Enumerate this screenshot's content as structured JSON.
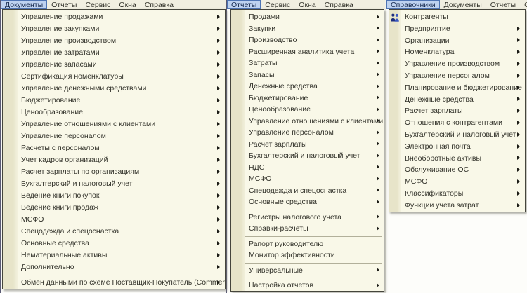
{
  "theme": {
    "bar-bg": "#f1efe1",
    "panel-bg": "#f9f8e8",
    "strip-a": "#e7e4c9",
    "strip-b": "#f3f1de",
    "sel-bg": "#bed2f0",
    "sel-border": "#4e74b4",
    "sel-text": "#16294e",
    "text": "#32322a",
    "panel-border": "#45453c",
    "sep": "#b2b09a",
    "arrow": "#1b1b15"
  },
  "windows": [
    {
      "id": "documents",
      "menubar": {
        "items": [
          {
            "label": "Документы",
            "selected": true
          },
          {
            "label": "Отчеты"
          },
          {
            "label": "Сервис",
            "u": 0
          },
          {
            "label": "Окна",
            "u": 0
          },
          {
            "label": "Справка",
            "u": 2
          }
        ]
      },
      "menu": {
        "items": [
          {
            "label": "Управление продажами",
            "submenu": true
          },
          {
            "label": "Управление закупками",
            "submenu": true
          },
          {
            "label": "Управление производством",
            "submenu": true
          },
          {
            "label": "Управление затратами",
            "submenu": true
          },
          {
            "label": "Управление запасами",
            "submenu": true
          },
          {
            "label": "Сертификация номенклатуры",
            "submenu": true
          },
          {
            "label": "Управление денежными средствами",
            "submenu": true
          },
          {
            "label": "Бюджетирование",
            "submenu": true
          },
          {
            "label": "Ценообразование",
            "submenu": true
          },
          {
            "label": "Управление отношениями с клиентами",
            "submenu": true
          },
          {
            "label": "Управление персоналом",
            "submenu": true
          },
          {
            "label": "Расчеты с персоналом",
            "submenu": true
          },
          {
            "label": "Учет кадров организаций",
            "submenu": true
          },
          {
            "label": "Расчет зарплаты по организациям",
            "submenu": true
          },
          {
            "label": "Бухгалтерский и налоговый учет",
            "submenu": true
          },
          {
            "label": "Ведение книги покупок",
            "submenu": true
          },
          {
            "label": "Ведение книги продаж",
            "submenu": true
          },
          {
            "label": "МСФО",
            "submenu": true
          },
          {
            "label": "Спецодежда и спецоснастка",
            "submenu": true
          },
          {
            "label": "Основные средства",
            "submenu": true
          },
          {
            "label": "Нематериальные активы",
            "submenu": true
          },
          {
            "label": "Дополнительно",
            "submenu": true
          },
          {
            "label": "Обмен данными по схеме Поставщик-Покупатель (CommerceML)",
            "submenu": true,
            "sep_before": true
          }
        ]
      }
    },
    {
      "id": "reports",
      "menubar": {
        "items": [
          {
            "label": "Отчеты",
            "selected": true
          },
          {
            "label": "Сервис",
            "u": 0
          },
          {
            "label": "Окна",
            "u": 0
          },
          {
            "label": "Справка",
            "u": 2
          }
        ]
      },
      "menu": {
        "items": [
          {
            "label": "Продажи",
            "submenu": true
          },
          {
            "label": "Закупки",
            "submenu": true
          },
          {
            "label": "Производство",
            "submenu": true
          },
          {
            "label": "Расширенная аналитика учета",
            "submenu": true
          },
          {
            "label": "Затраты",
            "submenu": true
          },
          {
            "label": "Запасы",
            "submenu": true
          },
          {
            "label": "Денежные средства",
            "submenu": true
          },
          {
            "label": "Бюджетирование",
            "submenu": true
          },
          {
            "label": "Ценообразование",
            "submenu": true
          },
          {
            "label": "Управление отношениями с клиентами",
            "submenu": true
          },
          {
            "label": "Управление персоналом",
            "submenu": true
          },
          {
            "label": "Расчет зарплаты",
            "submenu": true
          },
          {
            "label": "Бухгалтерский и налоговый учет",
            "submenu": true
          },
          {
            "label": "НДС",
            "submenu": true
          },
          {
            "label": "МСФО",
            "submenu": true
          },
          {
            "label": "Спецодежда и спецоснастка",
            "submenu": true
          },
          {
            "label": "Основные средства",
            "submenu": true
          },
          {
            "label": "Регистры налогового учета",
            "submenu": true,
            "sep_before": true
          },
          {
            "label": "Справки-расчеты",
            "submenu": true
          },
          {
            "label": "Рапорт руководителю",
            "submenu": false,
            "sep_before": true
          },
          {
            "label": "Монитор эффективности",
            "submenu": false
          },
          {
            "label": "Универсальные",
            "submenu": true,
            "sep_before": true
          },
          {
            "label": "Настройка отчетов",
            "submenu": true,
            "sep_before": true
          }
        ]
      }
    },
    {
      "id": "directories",
      "menubar": {
        "items": [
          {
            "label": "Справочники",
            "selected": true
          },
          {
            "label": "Документы"
          },
          {
            "label": "Отчеты"
          },
          {
            "label": "Сервис",
            "u": 0
          }
        ]
      },
      "menu": {
        "items": [
          {
            "label": "Контрагенты",
            "submenu": false,
            "icon": "contractors-icon"
          },
          {
            "label": "Предприятие",
            "submenu": true
          },
          {
            "label": "Организации",
            "submenu": true
          },
          {
            "label": "Номенклатура",
            "submenu": true
          },
          {
            "label": "Управление производством",
            "submenu": true
          },
          {
            "label": "Управление персоналом",
            "submenu": true
          },
          {
            "label": "Планирование и бюджетирование",
            "submenu": true
          },
          {
            "label": "Денежные средства",
            "submenu": true
          },
          {
            "label": "Расчет зарплаты",
            "submenu": true
          },
          {
            "label": "Отношения с контрагентами",
            "submenu": true
          },
          {
            "label": "Бухгалтерский и налоговый учет",
            "submenu": true
          },
          {
            "label": "Электронная почта",
            "submenu": true
          },
          {
            "label": "Внеоборотные активы",
            "submenu": true
          },
          {
            "label": "Обслуживание ОС",
            "submenu": true
          },
          {
            "label": "МСФО",
            "submenu": true
          },
          {
            "label": "Классификаторы",
            "submenu": true
          },
          {
            "label": "Функции учета затрат",
            "submenu": true
          }
        ]
      }
    }
  ]
}
